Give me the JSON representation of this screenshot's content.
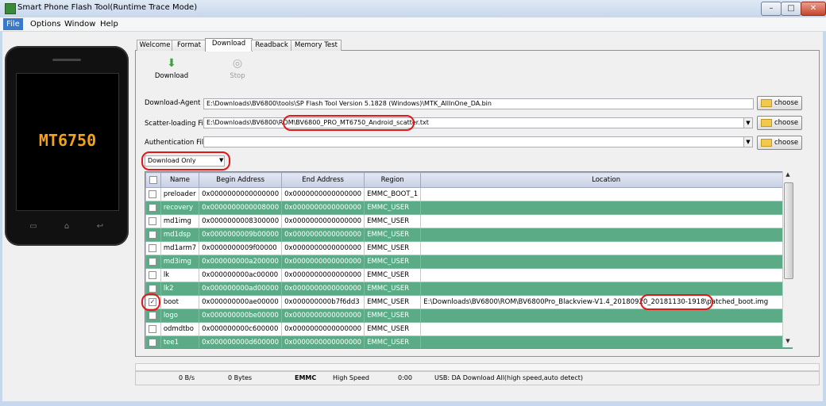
{
  "window": {
    "title": "Smart Phone Flash Tool(Runtime Trace Mode)",
    "min": "–",
    "max": "□",
    "close": "✕"
  },
  "menu": [
    "File",
    "Options",
    "Window",
    "Help"
  ],
  "phone": {
    "model": "MT6750"
  },
  "tabs": [
    "Welcome",
    "Format",
    "Download",
    "Readback",
    "Memory Test"
  ],
  "toolbar": {
    "download_label": "Download",
    "stop_label": "Stop"
  },
  "download_agent": {
    "label": "Download-Agent",
    "value": "E:\\Downloads\\BV6800\\tools\\SP Flash Tool Version 5.1828 (Windows)\\MTK_AllInOne_DA.bin",
    "button": "choose"
  },
  "scatter_file": {
    "label": "Scatter-loading File",
    "value": "E:\\Downloads\\BV6800\\ROM\\BV6800_PRO_MT6750_Android_scatter.txt",
    "button": "choose"
  },
  "auth_file": {
    "label": "Authentication File",
    "value": "",
    "button": "choose"
  },
  "mode_select": {
    "value": "Download Only"
  },
  "table": {
    "headers": [
      "Name",
      "Begin Address",
      "End Address",
      "Region",
      "Location"
    ],
    "rows": [
      {
        "checked": "",
        "name": "preloader",
        "begin": "0x0000000000000000",
        "end": "0x0000000000000000",
        "region": "EMMC_BOOT_1",
        "location": ""
      },
      {
        "checked": "",
        "name": "recovery",
        "begin": "0x0000000000008000",
        "end": "0x0000000000000000",
        "region": "EMMC_USER",
        "location": ""
      },
      {
        "checked": "",
        "name": "md1img",
        "begin": "0x0000000008300000",
        "end": "0x0000000000000000",
        "region": "EMMC_USER",
        "location": ""
      },
      {
        "checked": "",
        "name": "md1dsp",
        "begin": "0x0000000009b00000",
        "end": "0x0000000000000000",
        "region": "EMMC_USER",
        "location": ""
      },
      {
        "checked": "",
        "name": "md1arm7",
        "begin": "0x0000000009f00000",
        "end": "0x0000000000000000",
        "region": "EMMC_USER",
        "location": ""
      },
      {
        "checked": "",
        "name": "md3img",
        "begin": "0x000000000a200000",
        "end": "0x0000000000000000",
        "region": "EMMC_USER",
        "location": ""
      },
      {
        "checked": "",
        "name": "lk",
        "begin": "0x000000000ac00000",
        "end": "0x0000000000000000",
        "region": "EMMC_USER",
        "location": ""
      },
      {
        "checked": "",
        "name": "lk2",
        "begin": "0x000000000ad00000",
        "end": "0x0000000000000000",
        "region": "EMMC_USER",
        "location": ""
      },
      {
        "checked": "✓",
        "name": "boot",
        "begin": "0x000000000ae00000",
        "end": "0x000000000b7f6dd3",
        "region": "EMMC_USER",
        "location": "E:\\Downloads\\BV6800\\ROM\\BV6800Pro_Blackview-V1.4_20180920_20181130-1918\\patched_boot.img"
      },
      {
        "checked": "",
        "name": "logo",
        "begin": "0x000000000be00000",
        "end": "0x0000000000000000",
        "region": "EMMC_USER",
        "location": ""
      },
      {
        "checked": "",
        "name": "odmdtbo",
        "begin": "0x000000000c600000",
        "end": "0x0000000000000000",
        "region": "EMMC_USER",
        "location": ""
      },
      {
        "checked": "",
        "name": "tee1",
        "begin": "0x000000000d600000",
        "end": "0x0000000000000000",
        "region": "EMMC_USER",
        "location": ""
      }
    ]
  },
  "status": {
    "speed": "0 B/s",
    "bytes": "0 Bytes",
    "storage": "EMMC",
    "mode": "High Speed",
    "time": "0:00",
    "usb": "USB: DA Download All(high speed,auto detect)"
  },
  "colors": {
    "row_green": "#5aab86",
    "accent_red": "#e01818",
    "phone_text": "#f6a11a"
  }
}
